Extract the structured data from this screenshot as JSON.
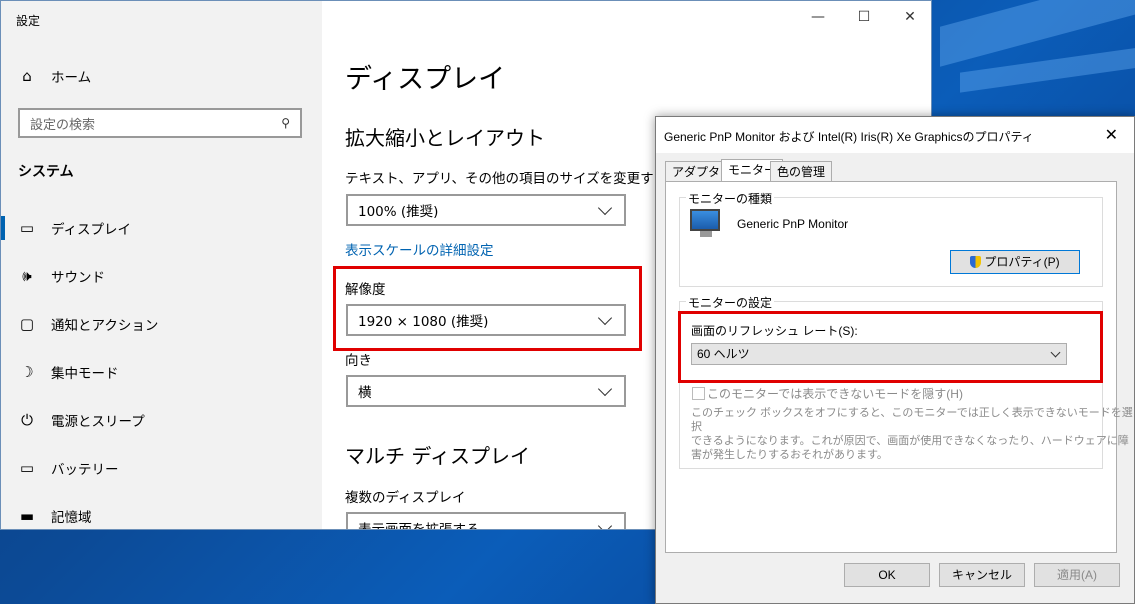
{
  "settings": {
    "app_title": "設定",
    "search_placeholder": "設定の検索",
    "section_header": "システム",
    "home_label": "ホーム",
    "nav_items": [
      {
        "label": "ディスプレイ",
        "icon": "monitor-icon"
      },
      {
        "label": "サウンド",
        "icon": "speaker-icon"
      },
      {
        "label": "通知とアクション",
        "icon": "notification-icon"
      },
      {
        "label": "集中モード",
        "icon": "moon-icon"
      },
      {
        "label": "電源とスリープ",
        "icon": "power-icon"
      },
      {
        "label": "バッテリー",
        "icon": "battery-icon"
      },
      {
        "label": "記憶域",
        "icon": "storage-icon"
      }
    ],
    "page_title": "ディスプレイ",
    "scale_section": "拡大縮小とレイアウト",
    "text_size_label": "テキスト、アプリ、その他の項目のサイズを変更する",
    "text_size_value": "100% (推奨)",
    "advanced_scale_link": "表示スケールの詳細設定",
    "resolution_label": "解像度",
    "resolution_value": "1920 × 1080 (推奨)",
    "orientation_label": "向き",
    "orientation_value": "横",
    "multi_display_section": "マルチ ディスプレイ",
    "multi_display_label": "複数のディスプレイ",
    "multi_display_value": "表示画面を拡張する"
  },
  "dialog": {
    "title": "Generic PnP Monitor および Intel(R) Iris(R) Xe Graphicsのプロパティ",
    "tabs": [
      "アダプター",
      "モニター",
      "色の管理"
    ],
    "monitor_type_group": "モニターの種類",
    "monitor_name": "Generic PnP Monitor",
    "properties_button": "プロパティ(P)",
    "monitor_settings_group": "モニターの設定",
    "refresh_rate_label": "画面のリフレッシュ レート(S):",
    "refresh_rate_value": "60 ヘルツ",
    "hide_modes_label": "このモニターでは表示できないモードを隠す(H)",
    "hide_modes_desc_1": "このチェック ボックスをオフにすると、このモニターでは正しく表示できないモードを選択",
    "hide_modes_desc_2": "できるようになります。これが原因で、画面が使用できなくなったり、ハードウェアに障",
    "hide_modes_desc_3": "害が発生したりするおそれがあります。",
    "ok_button": "OK",
    "cancel_button": "キャンセル",
    "apply_button": "適用(A)"
  }
}
